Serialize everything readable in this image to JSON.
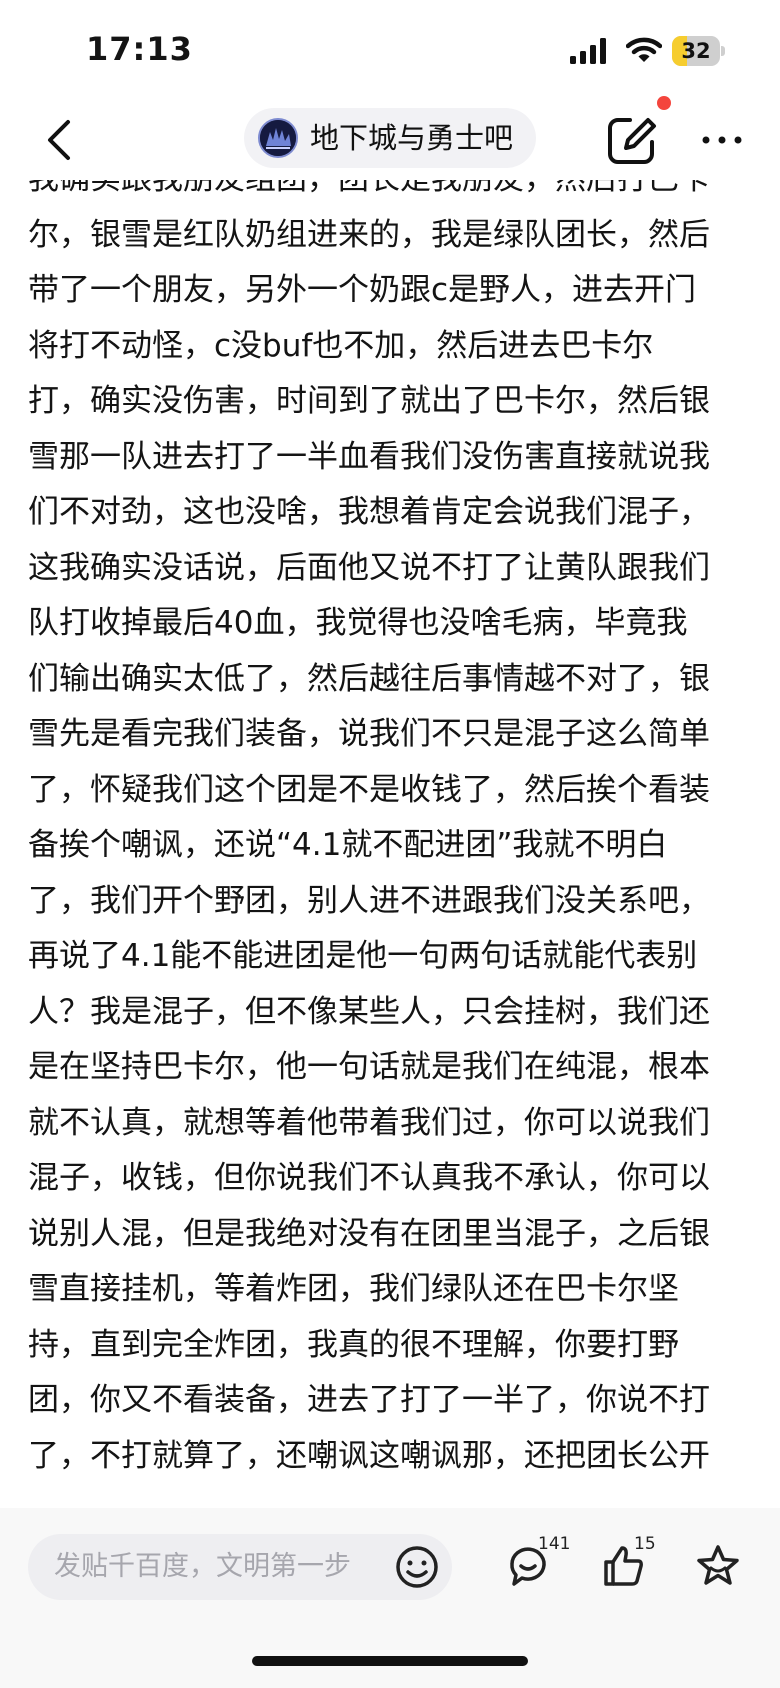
{
  "status_bar": {
    "time": "17:13",
    "battery_level": "32"
  },
  "nav": {
    "forum_name": "地下城与勇士吧"
  },
  "post": {
    "lines": [
      "我确实跟我朋友组团，团长是我朋友，然后打巴卡",
      "尔，银雪是红队奶组进来的，我是绿队团长，然后",
      "带了一个朋友，另外一个奶跟c是野人，进去开门",
      "将打不动怪，c没buf也不加，然后进去巴卡尔",
      "打，确实没伤害，时间到了就出了巴卡尔，然后银",
      "雪那一队进去打了一半血看我们没伤害直接就说我",
      "们不对劲，这也没啥，我想着肯定会说我们混子，",
      "这我确实没话说，后面他又说不打了让黄队跟我们",
      "队打收掉最后40血，我觉得也没啥毛病，毕竟我",
      "们输出确实太低了，然后越往后事情越不对了，银",
      "雪先是看完我们装备，说我们不只是混子这么简单",
      "了，怀疑我们这个团是不是收钱了，然后挨个看装",
      "备挨个嘲讽，还说“4.1就不配进团”我就不明白",
      "了，我们开个野团，别人进不进跟我们没关系吧，",
      "再说了4.1能不能进团是他一句两句话就能代表别",
      "人？我是混子，但不像某些人，只会挂树，我们还",
      "是在坚持巴卡尔，他一句话就是我们在纯混，根本",
      "就不认真，就想等着他带着我们过，你可以说我们",
      "混子，收钱，但你说我们不认真我不承认，你可以",
      "说别人混，但是我绝对没有在团里当混子，之后银",
      "雪直接挂机，等着炸团，我们绿队还在巴卡尔坚",
      "持，直到完全炸团，我真的很不理解，你要打野",
      "团，你又不看装备，进去了打了一半了，你说不打",
      "了，不打就算了，还嘲讽这嘲讽那，还把团长公开"
    ]
  },
  "bottom_bar": {
    "reply_placeholder": "发贴千百度，文明第一步",
    "comment_count": "141",
    "like_count": "15"
  },
  "colors": {
    "battery_fill": "#f6cd2f",
    "notification_dot": "#f4453d"
  },
  "icons": [
    "back-icon",
    "forum-logo",
    "edit-icon",
    "more-icon",
    "emoji-icon",
    "comment-icon",
    "like-icon",
    "star-icon"
  ]
}
